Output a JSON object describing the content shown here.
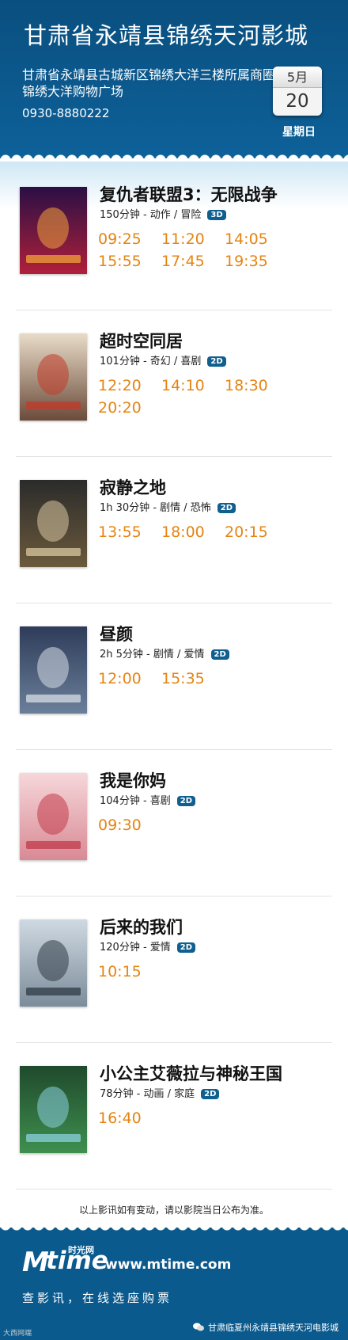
{
  "header": {
    "title": "甘肃省永靖县锦绣天河影城",
    "address": "甘肃省永靖县古城新区锦绣大洋三楼所属商圈锦绣大洋购物广场",
    "phone": "0930-8880222",
    "month": "5月",
    "day": "20",
    "weekday": "星期日"
  },
  "movies": [
    {
      "title": "复仇者联盟3：无限战争",
      "meta": "150分钟 - 动作 / 冒险",
      "format": "3D",
      "times": [
        "09:25",
        "11:20",
        "14:05",
        "15:55",
        "17:45",
        "19:35"
      ]
    },
    {
      "title": "超时空同居",
      "meta": "101分钟 - 奇幻 / 喜剧",
      "format": "2D",
      "times": [
        "12:20",
        "14:10",
        "18:30",
        "20:20"
      ]
    },
    {
      "title": "寂静之地",
      "meta": "1h 30分钟 - 剧情 / 恐怖",
      "format": "2D",
      "times": [
        "13:55",
        "18:00",
        "20:15"
      ]
    },
    {
      "title": "昼颜",
      "meta": "2h 5分钟 - 剧情 / 爱情",
      "format": "2D",
      "times": [
        "12:00",
        "15:35"
      ]
    },
    {
      "title": "我是你妈",
      "meta": "104分钟 - 喜剧",
      "format": "2D",
      "times": [
        "09:30"
      ]
    },
    {
      "title": "后来的我们",
      "meta": "120分钟 - 爱情",
      "format": "2D",
      "times": [
        "10:15"
      ]
    },
    {
      "title": "小公主艾薇拉与神秘王国",
      "meta": "78分钟 - 动画 / 家庭",
      "format": "2D",
      "times": [
        "16:40"
      ]
    }
  ],
  "footnote": "以上影讯如有变动，请以影院当日公布为准。",
  "footer": {
    "logo_letters": "time",
    "logo_cn": "时光网",
    "site": "www.mtime.com",
    "slogan": "查影讯，在线选座购票",
    "credit": "甘肃临夏州永靖县锦绣天河电影城",
    "watermark": "大西网端"
  }
}
